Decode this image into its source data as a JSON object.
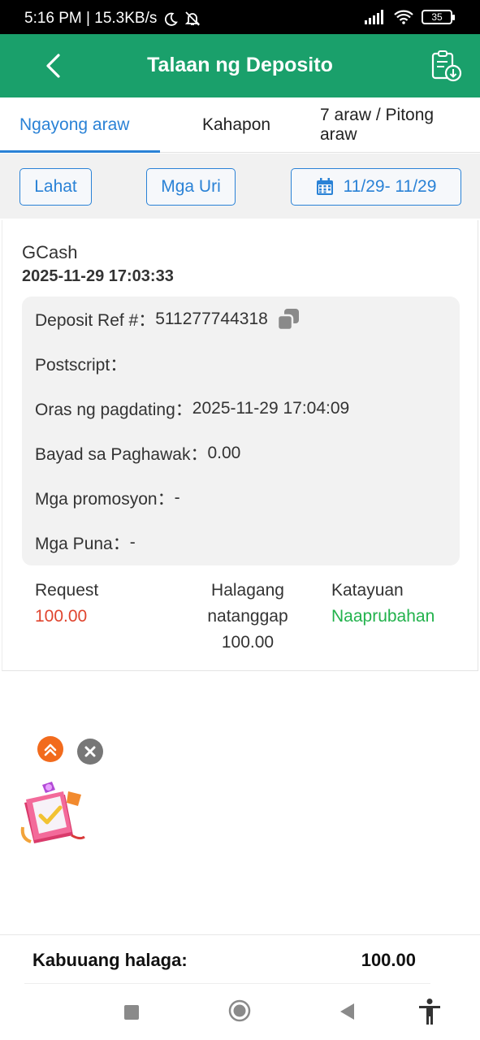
{
  "status_bar": {
    "time_speed": "5:16 PM | 15.3KB/s",
    "battery": "35"
  },
  "header": {
    "title": "Talaan ng Deposito",
    "icons": [
      "back-arrow-icon",
      "clipboard-download-icon"
    ]
  },
  "tabs": [
    {
      "label": "Ngayong araw",
      "active": true
    },
    {
      "label": "Kahapon",
      "active": false
    },
    {
      "label": "7 araw / Pitong araw",
      "active": false
    }
  ],
  "filters": {
    "all_label": "Lahat",
    "types_label": "Mga Uri",
    "date_range": "11/29- 11/29"
  },
  "record": {
    "channel": "GCash",
    "datetime": "2025-11-29 17:03:33",
    "details": [
      {
        "label": "Deposit Ref #：",
        "value": "511277744318"
      },
      {
        "label": "Postscript：",
        "value": ""
      },
      {
        "label": "Oras ng pagdating：",
        "value": "2025-11-29 17:04:09"
      },
      {
        "label": "Bayad sa Paghawak：",
        "value": "0.00"
      },
      {
        "label": "Mga promosyon：",
        "value": "-"
      },
      {
        "label": "Mga Puna：",
        "value": "-"
      }
    ],
    "request_label": "Request",
    "request_value": "100.00",
    "received_label_1": "Halagang",
    "received_label_2": "natanggap",
    "received_value": "100.00",
    "status_label": "Katayuan",
    "status_value": "Naaprubahan"
  },
  "colors": {
    "header_bg": "#1aa06b",
    "accent_blue": "#2a82d6",
    "request_red": "#e0452f",
    "status_green": "#22b24c"
  },
  "total": {
    "label": "Kabuuang halaga:",
    "value": "100.00"
  }
}
